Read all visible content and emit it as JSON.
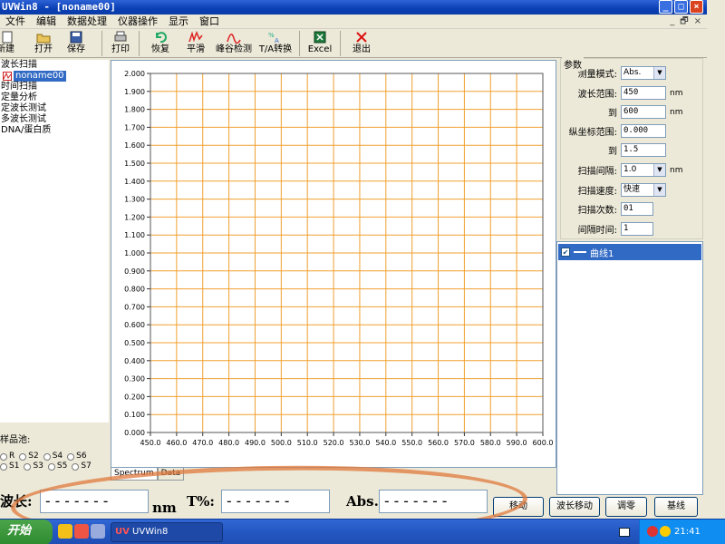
{
  "window": {
    "title": "UVWin8 - [noname00]",
    "controls": [
      "_",
      "□",
      "×"
    ],
    "mdi_controls": [
      "_",
      "🗗",
      "×"
    ]
  },
  "menu": [
    "文件",
    "编辑",
    "数据处理",
    "仪器操作",
    "显示",
    "窗口"
  ],
  "toolbar": [
    {
      "label": "新建",
      "icon": "new-file-icon"
    },
    {
      "label": "打开",
      "icon": "folder-open-icon"
    },
    {
      "label": "保存",
      "icon": "floppy-disk-icon"
    },
    {
      "label": "打印",
      "icon": "printer-icon"
    },
    {
      "label": "恢复",
      "icon": "undo-icon"
    },
    {
      "label": "平滑",
      "icon": "smooth-icon"
    },
    {
      "label": "峰谷检测",
      "icon": "peak-detect-icon"
    },
    {
      "label": "T/A转换",
      "icon": "convert-icon"
    },
    {
      "label": "Excel",
      "icon": "excel-icon"
    },
    {
      "label": "退出",
      "icon": "exit-icon"
    }
  ],
  "tree": {
    "root": "波长扫描",
    "selected": "noname00",
    "items": [
      "时间扫描",
      "定量分析",
      "定波长测试",
      "多波长测试",
      "DNA/蛋白质"
    ]
  },
  "sample": {
    "label": "样品池:",
    "row1": [
      "R",
      "S2",
      "S4",
      "S6"
    ],
    "row2": [
      "S1",
      "S3",
      "S5",
      "S7"
    ]
  },
  "tabs": [
    "Spectrum",
    "Data"
  ],
  "params": {
    "legend": "参数",
    "mode_label": "测量模式:",
    "mode_value": "Abs.",
    "wl_label": "波长范围:",
    "wl_from": "450",
    "wl_unit": "nm",
    "to_label": "到",
    "wl_to": "600",
    "y_label": "纵坐标范围:",
    "y_from": "0.000",
    "y_to": "1.5",
    "interval_label": "扫描间隔:",
    "interval_value": "1.0",
    "interval_unit": "nm",
    "speed_label": "扫描速度:",
    "speed_value": "快速",
    "count_label": "扫描次数:",
    "count_value": "01",
    "gap_label": "间隔时间:",
    "gap_value": "1"
  },
  "curves": [
    {
      "label": "曲线1",
      "checked": true,
      "color": "#ffffff"
    }
  ],
  "readout": {
    "wl_label": "波长:",
    "wl_value": "-------",
    "wl_unit": "nm",
    "t_label": "T%:",
    "t_value": "-------",
    "abs_label": "Abs.:",
    "abs_value": "-------"
  },
  "buttons": [
    "移动",
    "波长移动",
    "调零",
    "基线"
  ],
  "taskbar": {
    "start": "开始",
    "task": "UVWin8",
    "time": "21:41"
  },
  "colors": {
    "grid": "#f0a030",
    "title": "#0a3fb5",
    "selection": "#316ac5",
    "annotation": "#e07a3e"
  },
  "chart_data": {
    "type": "line",
    "x_ticks": [
      "450.0",
      "460.0",
      "470.0",
      "480.0",
      "490.0",
      "500.0",
      "510.0",
      "520.0",
      "530.0",
      "540.0",
      "550.0",
      "560.0",
      "570.0",
      "580.0",
      "590.0",
      "600.0"
    ],
    "y_ticks": [
      "0.000",
      "0.100",
      "0.200",
      "0.300",
      "0.400",
      "0.500",
      "0.600",
      "0.700",
      "0.800",
      "0.900",
      "1.000",
      "1.100",
      "1.200",
      "1.300",
      "1.400",
      "1.500",
      "1.600",
      "1.700",
      "1.800",
      "1.900",
      "2.000"
    ],
    "xlim": [
      450,
      600
    ],
    "ylim": [
      0,
      2
    ],
    "grid": true,
    "series": []
  }
}
